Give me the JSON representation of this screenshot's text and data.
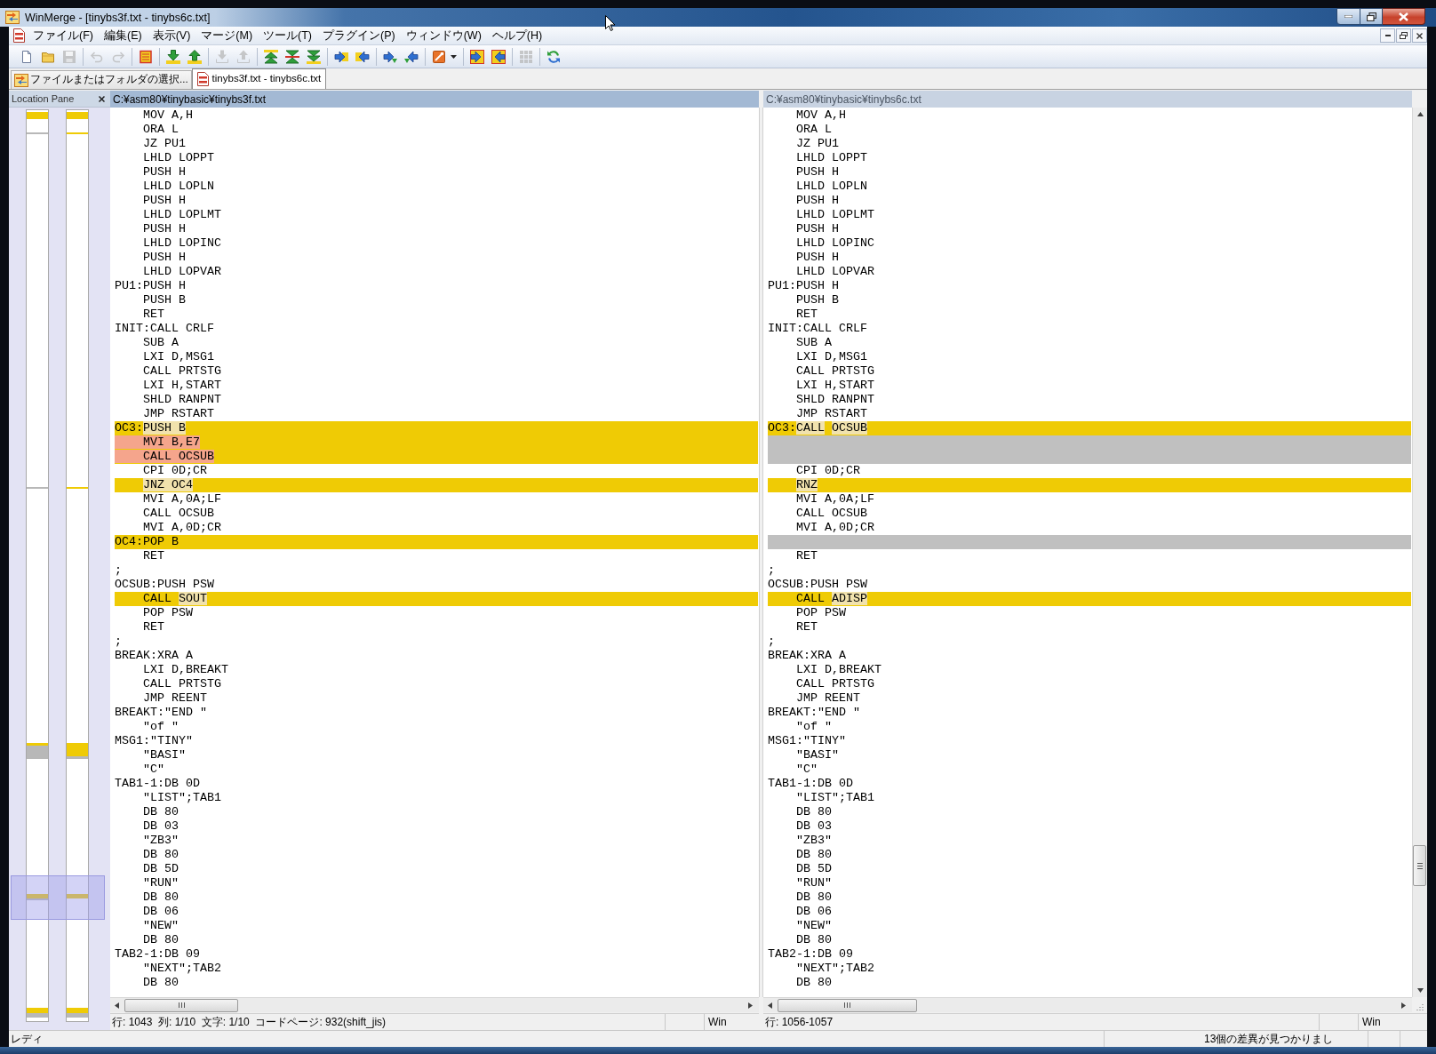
{
  "window": {
    "title": "WinMerge - [tinybs3f.txt - tinybs6c.txt]"
  },
  "menu": [
    "ファイル(F)",
    "編集(E)",
    "表示(V)",
    "マージ(M)",
    "ツール(T)",
    "プラグイン(P)",
    "ウィンドウ(W)",
    "ヘルプ(H)"
  ],
  "toolbar": [
    [
      {
        "kind": "new",
        "disabled": false
      },
      {
        "kind": "open",
        "disabled": false
      },
      {
        "kind": "save",
        "disabled": true
      }
    ],
    [
      {
        "kind": "undo",
        "disabled": true
      },
      {
        "kind": "redo",
        "disabled": true
      }
    ],
    [
      {
        "kind": "filter",
        "disabled": false
      }
    ],
    [
      {
        "kind": "nextdiff",
        "disabled": false
      },
      {
        "kind": "prevdiff",
        "disabled": false
      }
    ],
    [
      {
        "kind": "nextconflict",
        "disabled": true
      },
      {
        "kind": "prevconflict",
        "disabled": true
      }
    ],
    [
      {
        "kind": "firstdiff",
        "disabled": false
      },
      {
        "kind": "currentdiff",
        "disabled": false
      },
      {
        "kind": "lastdiff",
        "disabled": false
      }
    ],
    [
      {
        "kind": "copyright",
        "disabled": false
      },
      {
        "kind": "copyleft",
        "disabled": false
      }
    ],
    [
      {
        "kind": "copyrightnext",
        "disabled": false
      },
      {
        "kind": "copyleftnext",
        "disabled": false
      }
    ],
    [
      {
        "kind": "options",
        "disabled": false
      }
    ],
    [
      {
        "kind": "allright",
        "disabled": false
      },
      {
        "kind": "allleft",
        "disabled": false
      }
    ],
    [
      {
        "kind": "grid",
        "disabled": true
      }
    ],
    [
      {
        "kind": "refresh",
        "disabled": false
      }
    ]
  ],
  "tabs": [
    {
      "kind": "select",
      "label": "ファイルまたはフォルダの選択...",
      "selected": false
    },
    {
      "kind": "compare",
      "label": "tinybs3f.txt - tinybs6c.txt",
      "selected": true
    }
  ],
  "location_pane": {
    "title": "Location Pane"
  },
  "panes": [
    {
      "path": "C:¥asm80¥tinybasic¥tinybs3f.txt",
      "active": true,
      "lines": [
        {
          "kind": "same",
          "text": "\tMOV A,H"
        },
        {
          "kind": "same",
          "text": "\tORA L"
        },
        {
          "kind": "same",
          "text": "\tJZ PU1"
        },
        {
          "kind": "same",
          "text": "\tLHLD LOPPT"
        },
        {
          "kind": "same",
          "text": "\tPUSH H"
        },
        {
          "kind": "same",
          "text": "\tLHLD LOPLN"
        },
        {
          "kind": "same",
          "text": "\tPUSH H"
        },
        {
          "kind": "same",
          "text": "\tLHLD LOPLMT"
        },
        {
          "kind": "same",
          "text": "\tPUSH H"
        },
        {
          "kind": "same",
          "text": "\tLHLD LOPINC"
        },
        {
          "kind": "same",
          "text": "\tPUSH H"
        },
        {
          "kind": "same",
          "text": "\tLHLD LOPVAR"
        },
        {
          "kind": "same",
          "text": "PU1:PUSH H"
        },
        {
          "kind": "same",
          "text": "\tPUSH B"
        },
        {
          "kind": "same",
          "text": "\tRET"
        },
        {
          "kind": "same",
          "text": "INIT:CALL CRLF"
        },
        {
          "kind": "same",
          "text": "\tSUB A"
        },
        {
          "kind": "same",
          "text": "\tLXI D,MSG1"
        },
        {
          "kind": "same",
          "text": "\tCALL PRTSTG"
        },
        {
          "kind": "same",
          "text": "\tLXI H,START"
        },
        {
          "kind": "same",
          "text": "\tSHLD RANPNT"
        },
        {
          "kind": "same",
          "text": "\tJMP RSTART"
        },
        {
          "kind": "diff",
          "segments": [
            {
              "kind": "plain",
              "text": "OC3:"
            },
            {
              "kind": "word",
              "text": "PUSH B"
            }
          ]
        },
        {
          "kind": "diff",
          "segments": [
            {
              "kind": "removed",
              "text": "\tMVI B,E7"
            }
          ]
        },
        {
          "kind": "diff",
          "segments": [
            {
              "kind": "removed",
              "text": "\tCALL OCSUB"
            }
          ]
        },
        {
          "kind": "same",
          "text": "\tCPI 0D;CR"
        },
        {
          "kind": "diff",
          "segments": [
            {
              "kind": "word",
              "text": "\tJNZ OC4"
            }
          ]
        },
        {
          "kind": "same",
          "text": "\tMVI A,0A;LF"
        },
        {
          "kind": "same",
          "text": "\tCALL OCSUB"
        },
        {
          "kind": "same",
          "text": "\tMVI A,0D;CR"
        },
        {
          "kind": "diff",
          "segments": [
            {
              "kind": "plain",
              "text": "OC4:POP B"
            }
          ]
        },
        {
          "kind": "same",
          "text": "\tRET"
        },
        {
          "kind": "same",
          "text": ";"
        },
        {
          "kind": "same",
          "text": "OCSUB:PUSH PSW"
        },
        {
          "kind": "diff",
          "segments": [
            {
              "kind": "plain",
              "text": "\tCALL "
            },
            {
              "kind": "word",
              "text": "SOUT"
            }
          ]
        },
        {
          "kind": "same",
          "text": "\tPOP PSW"
        },
        {
          "kind": "same",
          "text": "\tRET"
        },
        {
          "kind": "same",
          "text": ";"
        },
        {
          "kind": "same",
          "text": "BREAK:XRA A"
        },
        {
          "kind": "same",
          "text": "\tLXI D,BREAKT"
        },
        {
          "kind": "same",
          "text": "\tCALL PRTSTG"
        },
        {
          "kind": "same",
          "text": "\tJMP REENT"
        },
        {
          "kind": "same",
          "text": "BREAKT:\"END \""
        },
        {
          "kind": "same",
          "text": "\t\"of \""
        },
        {
          "kind": "same",
          "text": "MSG1:\"TINY\""
        },
        {
          "kind": "same",
          "text": "\t\"BASI\""
        },
        {
          "kind": "same",
          "text": "\t\"C\""
        },
        {
          "kind": "same",
          "text": "TAB1-1:DB 0D"
        },
        {
          "kind": "same",
          "text": "\t\"LIST\";TAB1"
        },
        {
          "kind": "same",
          "text": "\tDB 80"
        },
        {
          "kind": "same",
          "text": "\tDB 03"
        },
        {
          "kind": "same",
          "text": "\t\"ZB3\""
        },
        {
          "kind": "same",
          "text": "\tDB 80"
        },
        {
          "kind": "same",
          "text": "\tDB 5D"
        },
        {
          "kind": "same",
          "text": "\t\"RUN\""
        },
        {
          "kind": "same",
          "text": "\tDB 80"
        },
        {
          "kind": "same",
          "text": "\tDB 06"
        },
        {
          "kind": "same",
          "text": "\t\"NEW\""
        },
        {
          "kind": "same",
          "text": "\tDB 80"
        },
        {
          "kind": "same",
          "text": "TAB2-1:DB 09"
        },
        {
          "kind": "same",
          "text": "\t\"NEXT\";TAB2"
        },
        {
          "kind": "same",
          "text": "\tDB 80"
        }
      ],
      "status": {
        "position": "行: 1043  列: 1/10  文字: 1/10  コードページ: 932(shift_jis)",
        "eol": "Win"
      }
    },
    {
      "path": "C:¥asm80¥tinybasic¥tinybs6c.txt",
      "active": false,
      "lines": [
        {
          "kind": "same",
          "text": "\tMOV A,H"
        },
        {
          "kind": "same",
          "text": "\tORA L"
        },
        {
          "kind": "same",
          "text": "\tJZ PU1"
        },
        {
          "kind": "same",
          "text": "\tLHLD LOPPT"
        },
        {
          "kind": "same",
          "text": "\tPUSH H"
        },
        {
          "kind": "same",
          "text": "\tLHLD LOPLN"
        },
        {
          "kind": "same",
          "text": "\tPUSH H"
        },
        {
          "kind": "same",
          "text": "\tLHLD LOPLMT"
        },
        {
          "kind": "same",
          "text": "\tPUSH H"
        },
        {
          "kind": "same",
          "text": "\tLHLD LOPINC"
        },
        {
          "kind": "same",
          "text": "\tPUSH H"
        },
        {
          "kind": "same",
          "text": "\tLHLD LOPVAR"
        },
        {
          "kind": "same",
          "text": "PU1:PUSH H"
        },
        {
          "kind": "same",
          "text": "\tPUSH B"
        },
        {
          "kind": "same",
          "text": "\tRET"
        },
        {
          "kind": "same",
          "text": "INIT:CALL CRLF"
        },
        {
          "kind": "same",
          "text": "\tSUB A"
        },
        {
          "kind": "same",
          "text": "\tLXI D,MSG1"
        },
        {
          "kind": "same",
          "text": "\tCALL PRTSTG"
        },
        {
          "kind": "same",
          "text": "\tLXI H,START"
        },
        {
          "kind": "same",
          "text": "\tSHLD RANPNT"
        },
        {
          "kind": "same",
          "text": "\tJMP RSTART"
        },
        {
          "kind": "diff",
          "segments": [
            {
              "kind": "plain",
              "text": "OC3:"
            },
            {
              "kind": "word",
              "text": "CALL"
            },
            {
              "kind": "word",
              "text": " OCSUB"
            }
          ]
        },
        {
          "kind": "missing"
        },
        {
          "kind": "missing"
        },
        {
          "kind": "same",
          "text": "\tCPI 0D;CR"
        },
        {
          "kind": "diff",
          "segments": [
            {
              "kind": "word",
              "text": "\tRNZ"
            }
          ]
        },
        {
          "kind": "same",
          "text": "\tMVI A,0A;LF"
        },
        {
          "kind": "same",
          "text": "\tCALL OCSUB"
        },
        {
          "kind": "same",
          "text": "\tMVI A,0D;CR"
        },
        {
          "kind": "missing"
        },
        {
          "kind": "same",
          "text": "\tRET"
        },
        {
          "kind": "same",
          "text": ";"
        },
        {
          "kind": "same",
          "text": "OCSUB:PUSH PSW"
        },
        {
          "kind": "diff",
          "segments": [
            {
              "kind": "plain",
              "text": "\tCALL "
            },
            {
              "kind": "word",
              "text": "ADISP"
            }
          ]
        },
        {
          "kind": "same",
          "text": "\tPOP PSW"
        },
        {
          "kind": "same",
          "text": "\tRET"
        },
        {
          "kind": "same",
          "text": ";"
        },
        {
          "kind": "same",
          "text": "BREAK:XRA A"
        },
        {
          "kind": "same",
          "text": "\tLXI D,BREAKT"
        },
        {
          "kind": "same",
          "text": "\tCALL PRTSTG"
        },
        {
          "kind": "same",
          "text": "\tJMP REENT"
        },
        {
          "kind": "same",
          "text": "BREAKT:\"END \""
        },
        {
          "kind": "same",
          "text": "\t\"of \""
        },
        {
          "kind": "same",
          "text": "MSG1:\"TINY\""
        },
        {
          "kind": "same",
          "text": "\t\"BASI\""
        },
        {
          "kind": "same",
          "text": "\t\"C\""
        },
        {
          "kind": "same",
          "text": "TAB1-1:DB 0D"
        },
        {
          "kind": "same",
          "text": "\t\"LIST\";TAB1"
        },
        {
          "kind": "same",
          "text": "\tDB 80"
        },
        {
          "kind": "same",
          "text": "\tDB 03"
        },
        {
          "kind": "same",
          "text": "\t\"ZB3\""
        },
        {
          "kind": "same",
          "text": "\tDB 80"
        },
        {
          "kind": "same",
          "text": "\tDB 5D"
        },
        {
          "kind": "same",
          "text": "\t\"RUN\""
        },
        {
          "kind": "same",
          "text": "\tDB 80"
        },
        {
          "kind": "same",
          "text": "\tDB 06"
        },
        {
          "kind": "same",
          "text": "\t\"NEW\""
        },
        {
          "kind": "same",
          "text": "\tDB 80"
        },
        {
          "kind": "same",
          "text": "TAB2-1:DB 09"
        },
        {
          "kind": "same",
          "text": "\t\"NEXT\";TAB2"
        },
        {
          "kind": "same",
          "text": "\tDB 80"
        }
      ],
      "status": {
        "position": "行: 1056-1057",
        "eol": "Win"
      }
    }
  ],
  "status_bar": {
    "message": "レディ",
    "differences": "13個の差異が見つかりまし"
  }
}
